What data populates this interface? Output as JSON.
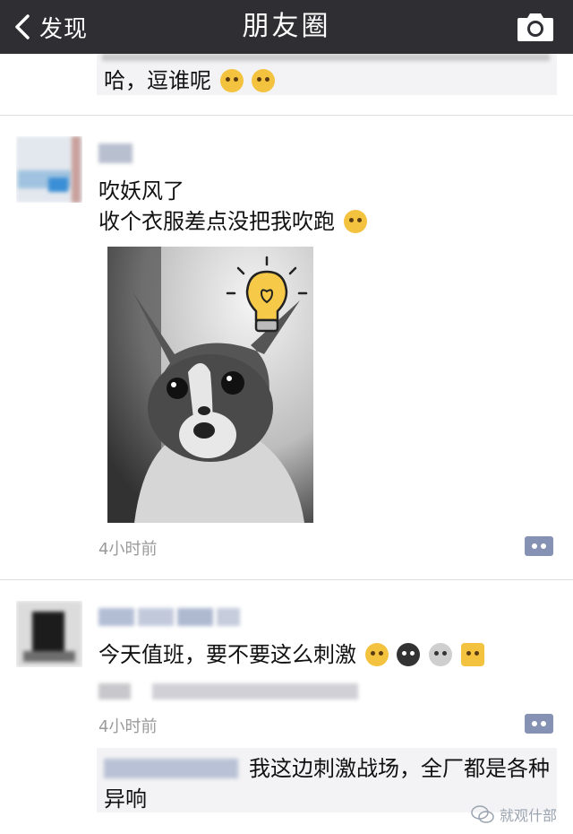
{
  "nav": {
    "back_label": "发现",
    "title": "朋友圈",
    "camera_icon": "camera-icon"
  },
  "top_reply": {
    "text": "哈，逗谁呢",
    "emojis": [
      "laugh-emoji",
      "laugh-emoji"
    ]
  },
  "post1": {
    "line1": "吹妖风了",
    "line2": "收个衣服差点没把我吹跑",
    "emoji": "dizzy-emoji",
    "image": "cat-with-lightbulb-photo",
    "time": "4小时前"
  },
  "post2": {
    "text": "今天值班，要不要这么刺激",
    "emojis": [
      "dizzy-emoji",
      "owl-emoji",
      "skull-emoji",
      "lightning-emoji"
    ],
    "time": "4小时前",
    "reply_text": "我这边刺激战场，全厂都是各种异响"
  },
  "watermark": {
    "text": "就观什部"
  },
  "colors": {
    "navbar": "#2f2f33",
    "link_blue": "#576b95",
    "comment_button": "#8592b3",
    "reply_bg": "#f3f3f5"
  }
}
